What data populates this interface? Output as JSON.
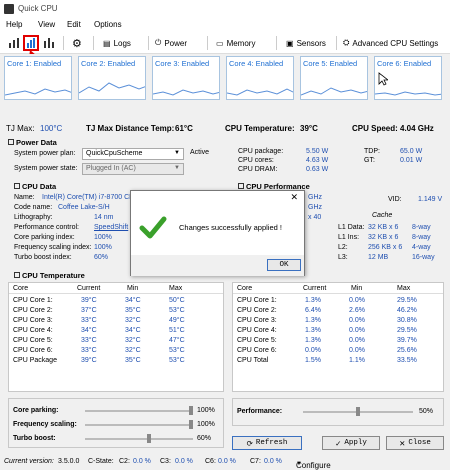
{
  "window": {
    "title": "Quick CPU"
  },
  "menu": [
    "Help",
    "View",
    "Edit",
    "Options"
  ],
  "toolbar": {
    "logs": "Logs",
    "power": "Power",
    "memory": "Memory",
    "sensors": "Sensors",
    "advanced": "Advanced CPU Settings"
  },
  "cores": [
    "Core 1: Enabled",
    "Core 2: Enabled",
    "Core 3: Enabled",
    "Core 4: Enabled",
    "Core 5: Enabled",
    "Core 6: Enabled"
  ],
  "summary": {
    "tjmax_label": "TJ Max:",
    "tjmax": "100°C",
    "tjdist_label": "TJ Max Distance Temp:",
    "tjdist": "61°C",
    "cputemp_label": "CPU Temperature:",
    "cputemp": "39°C",
    "cpuspeed_label": "CPU Speed:",
    "cpuspeed": "4.04 GHz"
  },
  "power": {
    "title": "Power Data",
    "plan_label": "System power plan:",
    "plan_value": "QuickCpuScheme",
    "plan_status": "Active",
    "state_label": "System power state:",
    "state_value": "Plugged In (AC)",
    "package_label": "CPU package:",
    "package": "5.50 W",
    "cores_label": "CPU cores:",
    "cores": "4.63 W",
    "dram_label": "CPU DRAM:",
    "dram": "0.63 W",
    "tdp_label": "TDP:",
    "tdp": "65.0 W",
    "gt_label": "GT:",
    "gt": "0.01 W"
  },
  "cpu": {
    "title": "CPU Data",
    "name_label": "Name:",
    "name": "Intel(R) Core(TM) i7-8700 CPU",
    "code_label": "Code name:",
    "code": "Coffee Lake-S/H",
    "litho_label": "Lithography:",
    "litho": "14 nm",
    "perf_label": "Performance control:",
    "perf": "SpeedShift",
    "park_label": "Core parking index:",
    "park": "100%",
    "freq_label": "Frequency scaling index:",
    "freq": "100%",
    "turbo_label": "Turbo boost index:",
    "turbo": "60%"
  },
  "perf": {
    "title": "CPU Performance",
    "ghz1": "GHz",
    "ghz2": "GHz",
    "x40": "x 40",
    "vid_label": "VID:",
    "vid": "1.149 V",
    "cache_title": "Cache",
    "cache": [
      {
        "label": "L1 Data:",
        "size": "32 KB x 6",
        "way": "8-way"
      },
      {
        "label": "L1 Ins:",
        "size": "32 KB x 6",
        "way": "8-way"
      },
      {
        "label": "L2:",
        "size": "256 KB x 6",
        "way": "4-way"
      },
      {
        "label": "L3:",
        "size": "12 MB",
        "way": "16-way"
      }
    ]
  },
  "temps": {
    "title": "CPU Temperature",
    "headers": [
      "Core",
      "Current",
      "Min",
      "Max"
    ],
    "rows": [
      [
        "CPU Core 1:",
        "39°C",
        "34°C",
        "50°C"
      ],
      [
        "CPU Core 2:",
        "37°C",
        "35°C",
        "53°C"
      ],
      [
        "CPU Core 3:",
        "33°C",
        "32°C",
        "49°C"
      ],
      [
        "CPU Core 4:",
        "34°C",
        "34°C",
        "51°C"
      ],
      [
        "CPU Core 5:",
        "33°C",
        "32°C",
        "47°C"
      ],
      [
        "CPU Core 6:",
        "33°C",
        "32°C",
        "53°C"
      ],
      [
        "CPU Package",
        "39°C",
        "35°C",
        "53°C"
      ]
    ]
  },
  "usage": {
    "headers": [
      "Core",
      "Current",
      "Min",
      "Max"
    ],
    "rows": [
      [
        "CPU Core 1:",
        "1.3%",
        "0.0%",
        "29.5%"
      ],
      [
        "CPU Core 2:",
        "6.4%",
        "2.6%",
        "46.2%"
      ],
      [
        "CPU Core 3:",
        "1.3%",
        "0.0%",
        "30.8%"
      ],
      [
        "CPU Core 4:",
        "1.3%",
        "0.0%",
        "29.5%"
      ],
      [
        "CPU Core 5:",
        "1.3%",
        "0.0%",
        "39.7%"
      ],
      [
        "CPU Core 6:",
        "0.0%",
        "0.0%",
        "25.6%"
      ],
      [
        "CPU Total",
        "1.5%",
        "1.1%",
        "33.5%"
      ]
    ]
  },
  "sliders": {
    "parking_label": "Core parking:",
    "parking": "100%",
    "parking_level": 1.0,
    "freq_label": "Frequency scaling:",
    "freq": "100%",
    "freq_level": 1.0,
    "turbo_label": "Turbo boost:",
    "turbo": "60%",
    "turbo_level": 0.6,
    "perf_label": "Performance:",
    "perf": "50%",
    "perf_level": 0.5
  },
  "buttons": {
    "refresh": "Refresh",
    "apply": "Apply",
    "close": "Close"
  },
  "dialog": {
    "message": "Changes successfully applied !",
    "ok": "OK"
  },
  "status": {
    "version_label": "Current version:",
    "version": "3.5.0.0",
    "cstate": "C-State:",
    "c2_label": "C2:",
    "c2": "0.0 %",
    "c3_label": "C3:",
    "c3": "0.0 %",
    "c6_label": "C6:",
    "c6": "0.0 %",
    "c7_label": "C7:",
    "c7": "0.0 %",
    "configure": "Configure"
  },
  "colors": {
    "accent": "#1f6fd2",
    "value": "#1f4fb0",
    "highlight": "#e00000",
    "check": "#3aa02b"
  }
}
